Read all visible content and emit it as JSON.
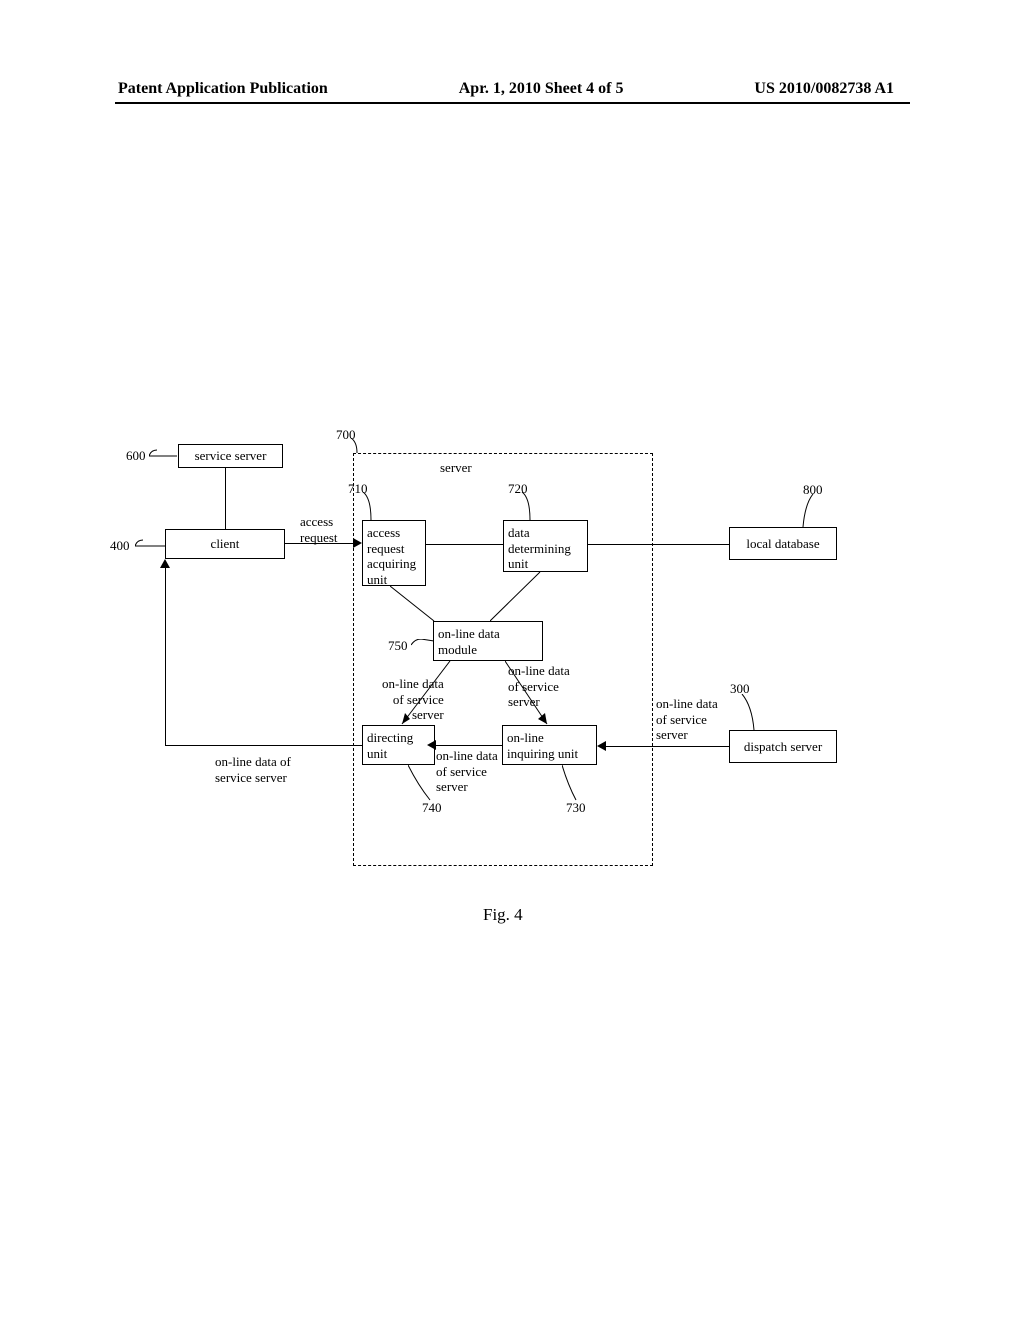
{
  "header": {
    "left": "Patent Application Publication",
    "mid": "Apr. 1, 2010   Sheet 4 of 5",
    "right": "US 2010/0082738 A1"
  },
  "refs": {
    "r600": "600",
    "r400": "400",
    "r700": "700",
    "r710": "710",
    "r720": "720",
    "r730": "730",
    "r740": "740",
    "r750": "750",
    "r800": "800",
    "r300": "300"
  },
  "blocks": {
    "service_server": "service server",
    "client": "client",
    "server": "server",
    "access_request_unit": "access\nrequest\nacquiring\nunit",
    "data_determining_unit": "data\ndetermining\nunit",
    "online_data_module": "on-line data\nmodule",
    "directing_unit": "directing\nunit",
    "online_inquiring_unit": "on-line\ninquiring unit",
    "local_database": "local database",
    "dispatch_server": "dispatch server"
  },
  "edges": {
    "access_request": "access\nrequest",
    "online_data_service_server": "on-line data of\nservice server",
    "online_data_service_server2": "on-line data\nof service\nserver",
    "online_data_service_server3": "on-line data\nof service\nserver",
    "online_data_service_server4": "on-line data\nof service\nserver",
    "online_data_service_server5": "on-line data\nof service\nserver"
  },
  "figure": "Fig. 4"
}
